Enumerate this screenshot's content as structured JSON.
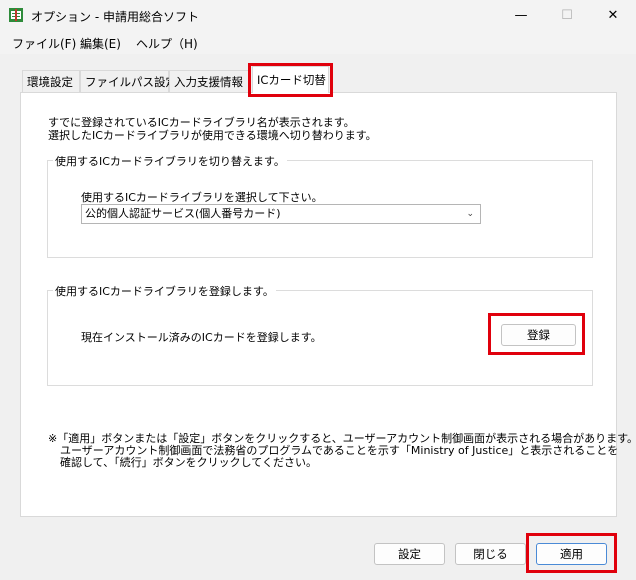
{
  "window": {
    "title": "オプション - 申請用総合ソフト",
    "minimize": "—",
    "maximize": "☐",
    "close": "✕"
  },
  "menu": [
    "ファイル(F)",
    "編集(E)",
    "ヘルプ（H)"
  ],
  "tabs": [
    "環境設定",
    "ファイルパス設定",
    "入力支援情報",
    "ICカード切替"
  ],
  "intro": [
    "すでに登録されているICカードライブラリ名が表示されます。",
    "選択したICカードライブラリが使用できる環境へ切り替わります。"
  ],
  "switch_group": {
    "title": "使用するICカードライブラリを切り替えます。",
    "label": "使用するICカードライブラリを選択して下さい。",
    "selected": "公的個人認証サービス(個人番号カード)"
  },
  "register_group": {
    "title": "使用するICカードライブラリを登録します。",
    "label": "現在インストール済みのICカードを登録します。",
    "button": "登録"
  },
  "notes": [
    "※「適用」ボタンまたは「設定」ボタンをクリックすると、ユーザーアカウント制御画面が表示される場合があります。",
    "ユーザーアカウント制御画面で法務省のプログラムであることを示す「Ministry of Justice」と表示されることを",
    "確認して、「続行」ボタンをクリックしてください。"
  ],
  "footer": {
    "settings": "設定",
    "close": "閉じる",
    "apply": "適用"
  },
  "colors": {
    "highlight": "#e0000c",
    "primary_border": "#4a8ad6"
  }
}
